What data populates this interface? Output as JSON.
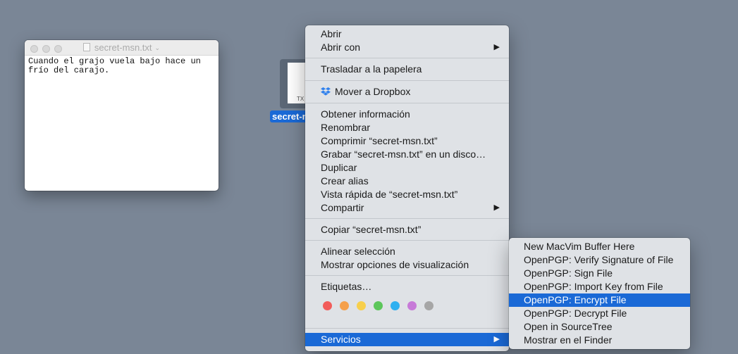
{
  "window": {
    "title": "secret-msn.txt",
    "content": "Cuando el grajo vuela bajo hace un\nfrío del carajo."
  },
  "file": {
    "label": "secret-m",
    "ext": "TX"
  },
  "menu": {
    "items": [
      {
        "label": "Abrir"
      },
      {
        "label": "Abrir con"
      },
      {
        "label": "Trasladar a la papelera"
      },
      {
        "label": "Mover a Dropbox"
      },
      {
        "label": "Obtener información"
      },
      {
        "label": "Renombrar"
      },
      {
        "label": "Comprimir “secret-msn.txt”"
      },
      {
        "label": "Grabar “secret-msn.txt” en un disco…"
      },
      {
        "label": "Duplicar"
      },
      {
        "label": "Crear alias"
      },
      {
        "label": "Vista rápida de “secret-msn.txt”"
      },
      {
        "label": "Compartir"
      },
      {
        "label": "Copiar “secret-msn.txt”"
      },
      {
        "label": "Alinear selección"
      },
      {
        "label": "Mostrar opciones de visualización"
      },
      {
        "label": "Etiquetas…"
      },
      {
        "label": "Servicios"
      }
    ],
    "tag_colors": [
      "#f25c5a",
      "#f5a04b",
      "#f7cf4c",
      "#5cc65a",
      "#2fb0f0",
      "#c77ad8",
      "#a6a6a6"
    ]
  },
  "services": {
    "items": [
      {
        "label": "New MacVim Buffer Here"
      },
      {
        "label": "OpenPGP: Verify Signature of File"
      },
      {
        "label": "OpenPGP: Sign File"
      },
      {
        "label": "OpenPGP: Import Key from File"
      },
      {
        "label": "OpenPGP: Encrypt File"
      },
      {
        "label": "OpenPGP: Decrypt File"
      },
      {
        "label": "Open in SourceTree"
      },
      {
        "label": "Mostrar en el Finder"
      }
    ]
  },
  "colors": {
    "desktop": "#7a8696",
    "highlight": "#1a69d6",
    "dropbox": "#2f80ed"
  }
}
